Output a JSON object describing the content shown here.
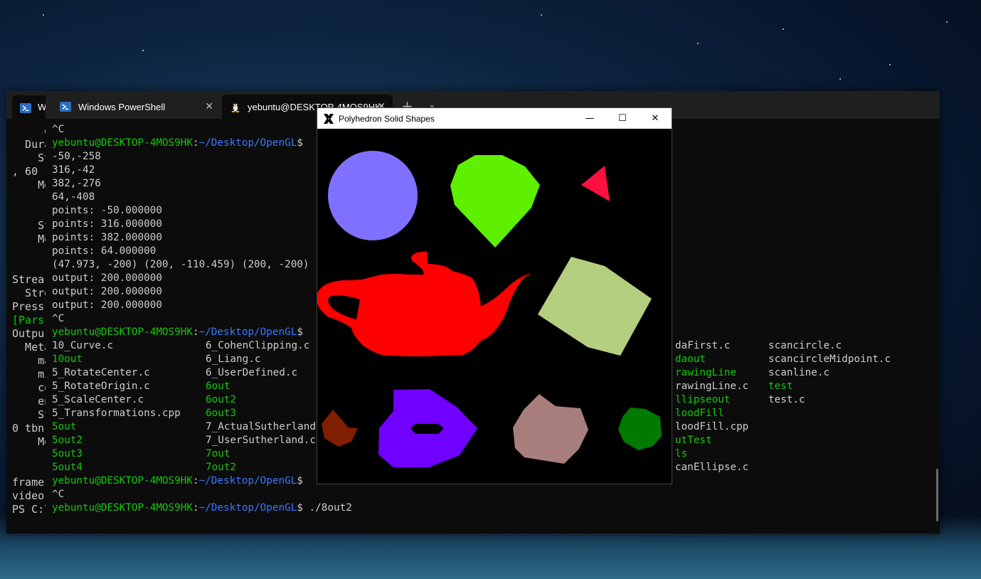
{
  "back_window": {
    "tab_label": "W",
    "lines": [
      "     er",
      "  Dura",
      "    St",
      ", 60 -",
      "    Me",
      "",
      "",
      "    St",
      "    Me",
      "",
      "",
      "Strea",
      "  Stre",
      "Press",
      "[Pars",
      "Outpu",
      "  Meta",
      "    ma",
      "    mi",
      "    co",
      "    en",
      "    St",
      "0 tbn",
      "    Me",
      "",
      "",
      "frame",
      "video",
      "PS C:\\"
    ],
    "caption": {
      "minimize": "—",
      "maximize": "☐",
      "close": "✕"
    }
  },
  "terminal": {
    "tabs": [
      {
        "label": "Windows PowerShell",
        "icon": "powershell-icon"
      },
      {
        "label": "yebuntu@DESKTOP-4MOS9HK:",
        "icon": "linux-penguin-icon"
      }
    ],
    "new_tab": "+",
    "dropdown": "⌄",
    "prompt_user": "yebuntu@DESKTOP-4MOS9HK",
    "prompt_path": "~/Desktop/OpenGL",
    "lines_top": [
      "^C",
      "@PROMPT",
      "-50,-258",
      "316,-42",
      "382,-276",
      "64,-408",
      "points: -50.000000",
      "points: 316.000000",
      "points: 382.000000",
      "points: 64.000000",
      "(47.973, -200) (200, -110.459) (200, -200)",
      "output: 200.000000",
      "output: 200.000000",
      "output: 200.000000",
      "^C",
      "@PROMPT"
    ],
    "listing": [
      {
        "c1": "10_Curve.c",
        "c1g": false,
        "c2": "6_CohenClipping.c",
        "c2g": false,
        "c3": "daFirst.c",
        "c3g": false,
        "c4": "scancircle.c",
        "c4g": false
      },
      {
        "c1": "10out",
        "c1g": true,
        "c2": "6_Liang.c",
        "c2g": false,
        "c3": "daout",
        "c3g": true,
        "c4": "scancircleMidpoint.c",
        "c4g": false
      },
      {
        "c1": "5_RotateCenter.c",
        "c1g": false,
        "c2": "6_UserDefined.c",
        "c2g": false,
        "c3": "rawingLine",
        "c3g": true,
        "c4": "scanline.c",
        "c4g": false
      },
      {
        "c1": "5_RotateOrigin.c",
        "c1g": false,
        "c2": "6out",
        "c2g": true,
        "c3": "rawingLine.c",
        "c3g": false,
        "c4": "test",
        "c4g": true
      },
      {
        "c1": "5_ScaleCenter.c",
        "c1g": false,
        "c2": "6out2",
        "c2g": true,
        "c3": "llipseout",
        "c3g": true,
        "c4": "test.c",
        "c4g": false
      },
      {
        "c1": "5_Transformations.cpp",
        "c1g": false,
        "c2": "6out3",
        "c2g": true,
        "c3": "loodFill",
        "c3g": true,
        "c4": "",
        "c4g": false
      },
      {
        "c1": "5out",
        "c1g": true,
        "c2": "7_ActualSutherland",
        "c2g": false,
        "c3": "loodFill.cpp",
        "c3g": false,
        "c4": "",
        "c4g": false
      },
      {
        "c1": "5out2",
        "c1g": true,
        "c2": "7_UserSutherland.cp",
        "c2g": false,
        "c3": "utTest",
        "c3g": true,
        "c4": "",
        "c4g": false
      },
      {
        "c1": "5out3",
        "c1g": true,
        "c2": "7out",
        "c2g": true,
        "c3": "ls",
        "c3g": true,
        "c4": "",
        "c4g": false
      },
      {
        "c1": "5out4",
        "c1g": true,
        "c2": "7out2",
        "c2g": true,
        "c3": "canEllipse.c",
        "c3g": false,
        "c4": "",
        "c4g": false
      }
    ],
    "lines_bottom": [
      "@PROMPT",
      "^C",
      "@PROMPT ./8out2"
    ]
  },
  "gl_window": {
    "title": "Polyhedron Solid Shapes",
    "icon": "x11-icon",
    "caption": {
      "minimize": "—",
      "maximize": "☐",
      "close": "✕"
    },
    "shapes": [
      {
        "name": "circle",
        "color": "#8070ff"
      },
      {
        "name": "diamond",
        "color": "#5ff000"
      },
      {
        "name": "triangle",
        "color": "#ff1040"
      },
      {
        "name": "teapot",
        "color": "#ff0000"
      },
      {
        "name": "cube",
        "color": "#b5cf80"
      },
      {
        "name": "small-polygon",
        "color": "#801e00"
      },
      {
        "name": "torus",
        "color": "#7000ff"
      },
      {
        "name": "octahedron",
        "color": "#a87e7c"
      },
      {
        "name": "dodecahedron",
        "color": "#007a00"
      }
    ]
  }
}
